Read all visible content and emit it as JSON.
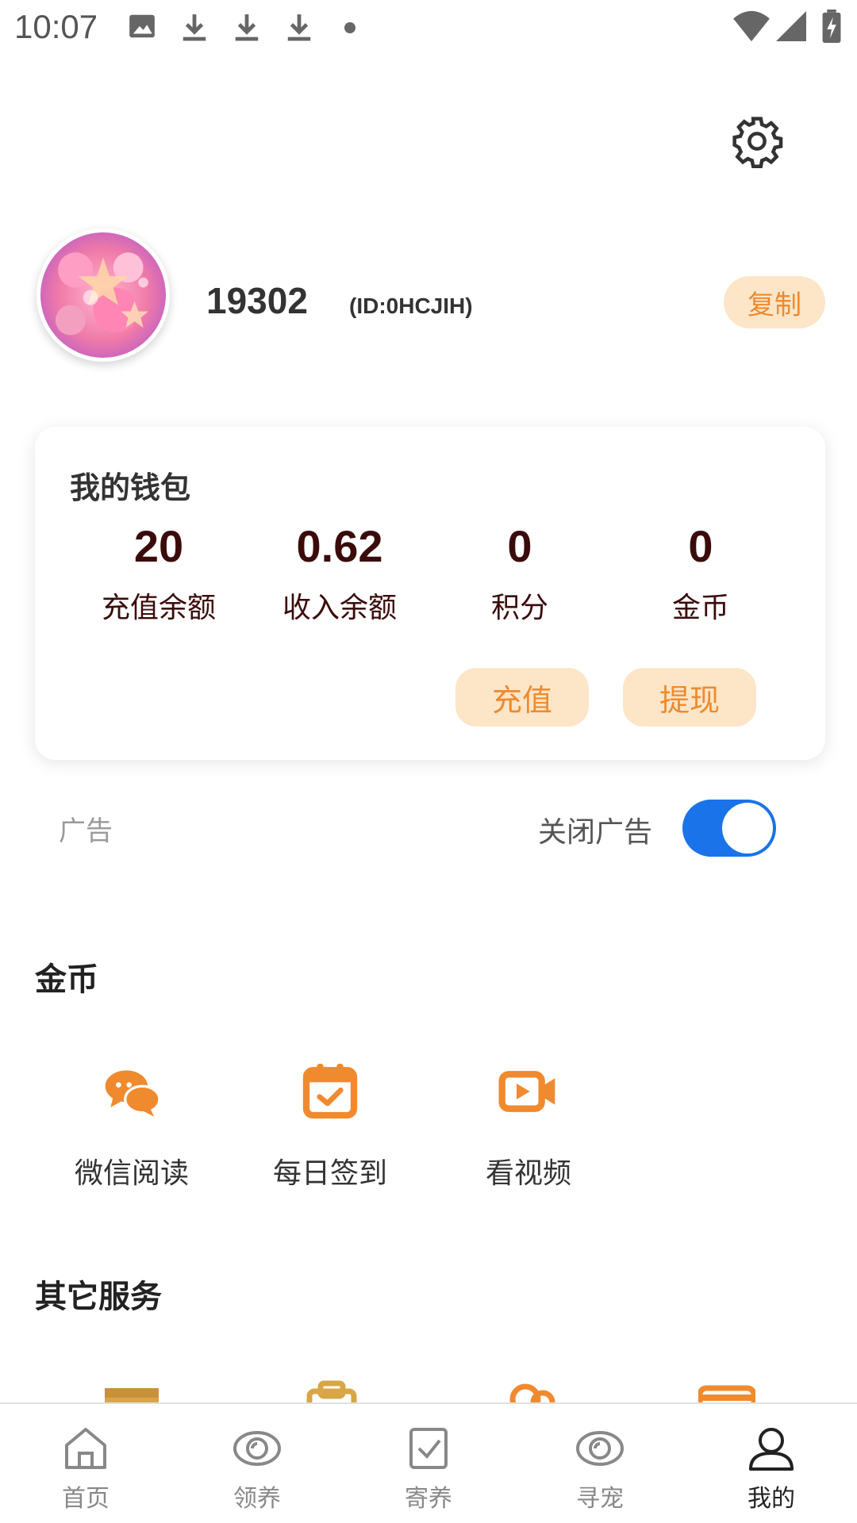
{
  "status_bar": {
    "time": "10:07",
    "left_icons": [
      "image-icon",
      "download-icon",
      "download-icon",
      "download-icon",
      "dot-icon"
    ],
    "right_icons": [
      "wifi-icon",
      "signal-icon",
      "battery-charging-icon"
    ]
  },
  "header": {
    "settings_icon": "gear-icon"
  },
  "profile": {
    "username": "19302",
    "user_id": "(ID:0HCJIH)",
    "copy_label": "复制"
  },
  "wallet": {
    "title": "我的钱包",
    "stats": [
      {
        "value": "20",
        "label": "充值余额"
      },
      {
        "value": "0.62",
        "label": "收入余额"
      },
      {
        "value": "0",
        "label": "积分"
      },
      {
        "value": "0",
        "label": "金币"
      }
    ],
    "recharge_label": "充值",
    "withdraw_label": "提现"
  },
  "ad": {
    "label": "广告",
    "close_label": "关闭广告",
    "close_enabled": true
  },
  "coins_section": {
    "title": "金币",
    "items": [
      {
        "label": "微信阅读",
        "icon": "chat-bubbles-icon"
      },
      {
        "label": "每日签到",
        "icon": "calendar-check-icon"
      },
      {
        "label": "看视频",
        "icon": "video-camera-icon"
      }
    ]
  },
  "other_section": {
    "title": "其它服务"
  },
  "tabs": [
    {
      "label": "首页",
      "icon": "home-icon",
      "active": false
    },
    {
      "label": "领养",
      "icon": "eye-icon",
      "active": false
    },
    {
      "label": "寄养",
      "icon": "checkbox-icon",
      "active": false
    },
    {
      "label": "寻宠",
      "icon": "eye-icon",
      "active": false
    },
    {
      "label": "我的",
      "icon": "person-icon",
      "active": true
    }
  ],
  "colors": {
    "accent_orange": "#ef8a2d",
    "pill_background": "#fde5c8",
    "toggle_blue": "#1a73e8",
    "stat_text": "#3b0b0b"
  }
}
